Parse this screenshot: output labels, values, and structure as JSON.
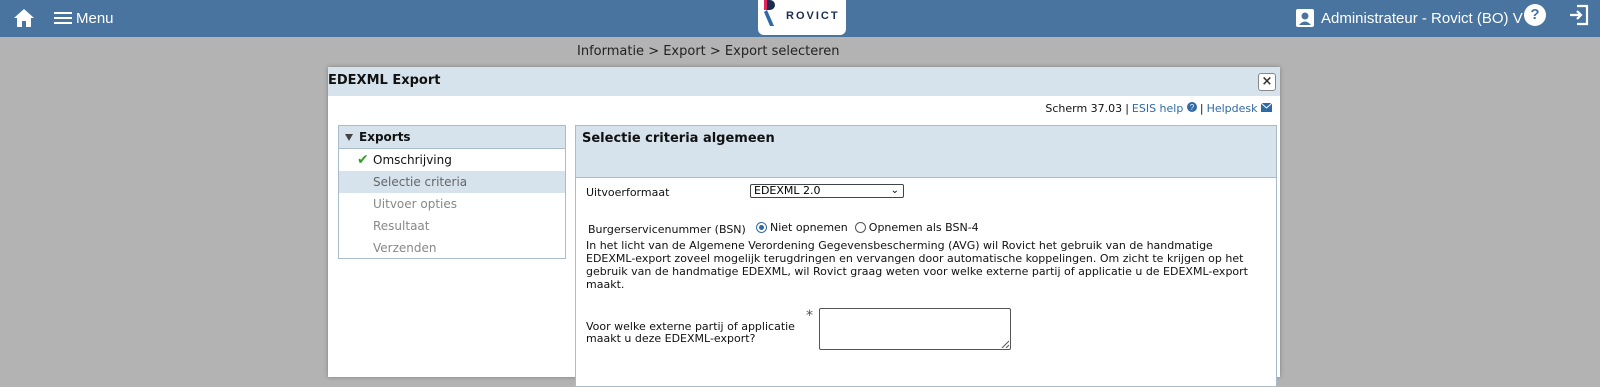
{
  "topbar": {
    "menu_label": "Menu",
    "logo_text": "ROVICT",
    "user_label": "Administrateur - Rovict (BO) V"
  },
  "breadcrumb": "Informatie > Export > Export selecteren",
  "dialog": {
    "title": "EDEXML Export",
    "close_label": "×",
    "screen_code": "Scherm 37.03",
    "esis_help": "ESIS help",
    "helpdesk": "Helpdesk"
  },
  "sidebar": {
    "header": "Exports",
    "items": [
      {
        "label": "Omschrijving"
      },
      {
        "label": "Selectie criteria"
      },
      {
        "label": "Uitvoer opties"
      },
      {
        "label": "Resultaat"
      },
      {
        "label": "Verzenden"
      }
    ]
  },
  "panel": {
    "title": "Selectie criteria algemeen",
    "format_label": "Uitvoerformaat",
    "format_value": "EDEXML 2.0",
    "bsn_label": "Burgerservicenummer (BSN)",
    "bsn_option1": "Niet opnemen",
    "bsn_option2": "Opnemen als BSN-4",
    "info_text": "In het licht van de Algemene Verordening Gegevensbescherming (AVG) wil Rovict het gebruik van de handmatige EDEXML-export zoveel mogelijk terugdringen en vervangen door automatische koppelingen. Om zicht te krijgen op het gebruik van de handmatige EDEXML, wil Rovict graag weten voor welke externe partij of applicatie u de EDEXML-export maakt.",
    "question_label": "Voor welke externe partij of applicatie maakt u deze EDEXML-export?",
    "required_mark": "*"
  },
  "colors": {
    "topbar": "#49749f",
    "panel_header": "#d7e3ec",
    "link": "#2f6aa6",
    "check": "#3a9b2e"
  }
}
